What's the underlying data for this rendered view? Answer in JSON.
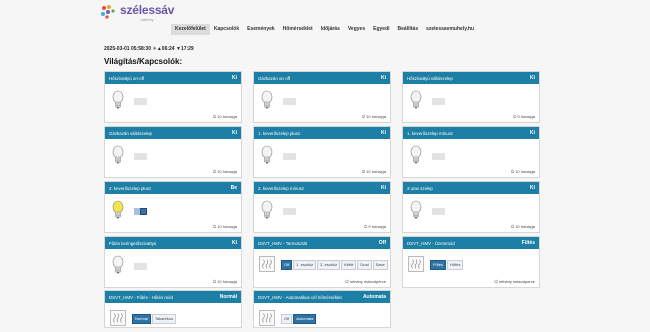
{
  "logo": {
    "name": "szélessáv",
    "sub": "műhely"
  },
  "nav": [
    "Kezelőfelület",
    "Kapcsolók",
    "Események",
    "Hőmérséklet",
    "Időjárás",
    "Vegyes",
    "Egyedi",
    "Beállítás",
    "szelessavmuhely.hu"
  ],
  "status_line": "2025-03-01 05:58:30 ☀▲06:24 ▼17:29",
  "page_title": "Világítás/Kapcsolók:",
  "cards": [
    {
      "title": "Hőszivattyú on-off",
      "state": "Ki",
      "type": "lamp",
      "on": false,
      "foot": "⏻ 10 hónapja"
    },
    {
      "title": "Gázkazán on-off",
      "state": "Ki",
      "type": "lamp",
      "on": false,
      "foot": "⏻ 10 hónapja"
    },
    {
      "title": "Hőszivattyú váltószelep",
      "state": "Ki",
      "type": "lamp",
      "on": false,
      "foot": "⏻ 9 hónapja"
    },
    {
      "title": "Gázkazán váltószelep",
      "state": "Ki",
      "type": "lamp",
      "on": false,
      "foot": "⏻ 10 hónapja"
    },
    {
      "title": "1. keverőszelep plusz",
      "state": "Ki",
      "type": "lamp",
      "on": false,
      "foot": "⏻ 10 hónapja"
    },
    {
      "title": "1. keverőszelep mínusz",
      "state": "Ki",
      "type": "lamp",
      "on": false,
      "foot": "⏻ 10 hónapja"
    },
    {
      "title": "2. keverőszelep plusz",
      "state": "Be",
      "type": "lamp",
      "on": true,
      "foot": "⏻ 10 hónapja"
    },
    {
      "title": "2. keverőszelep mínusz",
      "state": "Ki",
      "type": "lamp",
      "on": false,
      "foot": "⏻ 9 hónapja"
    },
    {
      "title": "3 utas szelep",
      "state": "Ki",
      "type": "lamp",
      "on": false,
      "foot": "⏻ 10 hónapja"
    },
    {
      "title": "Fűtés keringetőszivattyú",
      "state": "Ki",
      "type": "lamp",
      "on": false,
      "foot": "⏻ 10 hónapja"
    },
    {
      "title": "DSVT_HMV - Termosztát",
      "state": "Off",
      "type": "buttons",
      "buttons": [
        "Off",
        "1. eszköz",
        "2. eszköz",
        "Kétfé",
        "Dual",
        "Save"
      ],
      "selected": 0,
      "foot": "⏻ néhány másodperce"
    },
    {
      "title": "DSVT_HMV - Üzemmód",
      "state": "Fűtés",
      "type": "buttons",
      "buttons": [
        "Fűtés",
        "Hűtés"
      ],
      "selected": 0,
      "foot": "⏻ néhány másodperce"
    },
    {
      "title": "DSVT_HMV - Fűtés - Hűtés mód",
      "state": "Normál",
      "type": "buttons",
      "buttons": [
        "Normál",
        "Takarékos"
      ],
      "selected": 0,
      "foot": ""
    },
    {
      "title": "DSVT_HMV - Automatikus cél hőmérséklet",
      "state": "Automata",
      "type": "buttons",
      "buttons": [
        "Off",
        "Automata"
      ],
      "selected": 1,
      "foot": ""
    }
  ],
  "colors": {
    "header": "#1d7fa5",
    "bulb_on": "#f1e64a",
    "selected": "#2f73a6"
  }
}
